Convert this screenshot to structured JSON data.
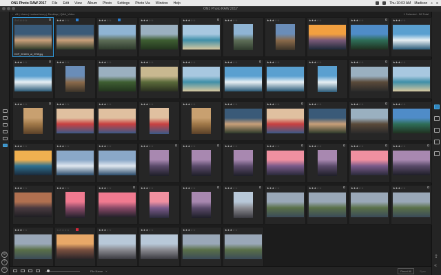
{
  "menubar": {
    "app_name": "ON1 Photo RAW 2017",
    "items": [
      "File",
      "Edit",
      "View",
      "Album",
      "Photo",
      "Settings",
      "Photo Via",
      "Window",
      "Help"
    ],
    "clock": "Thu 10:03 AM",
    "user": "Madison"
  },
  "window": {
    "title": "ON1 Photo RAW 2017"
  },
  "path": {
    "crumbs": "All | Users | hudsonhecry | Desktop | Q&A_Video",
    "selection": "1 Selected - 56 Total"
  },
  "left_rail": {
    "tools": [
      {
        "name": "browse",
        "label": "",
        "active": false
      },
      {
        "name": "develop",
        "label": "",
        "active": false
      },
      {
        "name": "effects",
        "label": "",
        "active": false
      },
      {
        "name": "layers",
        "label": "",
        "active": false
      },
      {
        "name": "resize",
        "label": "",
        "active": false
      },
      {
        "name": "smart-photo",
        "label": "",
        "active": true
      }
    ],
    "bottom": [
      "gear",
      "help",
      "power"
    ]
  },
  "right_rail": {
    "tools": [
      {
        "name": "browse",
        "label": "",
        "active": true
      },
      {
        "name": "develop",
        "label": "",
        "active": false
      },
      {
        "name": "effects",
        "label": "",
        "active": false
      },
      {
        "name": "layers",
        "label": "",
        "active": false
      },
      {
        "name": "resize",
        "label": "",
        "active": false
      }
    ]
  },
  "photos": [
    {
      "stars": 0,
      "label": "",
      "check": true,
      "kind": "family",
      "orient": "land",
      "filename": "DCP_201601_at_0708.jpg",
      "selected": true
    },
    {
      "stars": 3,
      "label": "#2a7fd4",
      "check": false,
      "kind": "family",
      "orient": "land"
    },
    {
      "stars": 3,
      "label": "#2a7fd4",
      "check": false,
      "kind": "cliff",
      "orient": "land"
    },
    {
      "stars": 3,
      "label": "",
      "check": false,
      "kind": "valley",
      "orient": "land"
    },
    {
      "stars": 3,
      "label": "",
      "check": true,
      "kind": "beach",
      "orient": "land"
    },
    {
      "stars": 3,
      "label": "",
      "check": false,
      "kind": "cliff",
      "orient": "port"
    },
    {
      "stars": 3,
      "label": "",
      "check": false,
      "kind": "climb",
      "orient": "port"
    },
    {
      "stars": 3,
      "label": "",
      "check": false,
      "kind": "sunset",
      "orient": "land"
    },
    {
      "stars": 3,
      "label": "",
      "check": true,
      "kind": "coast",
      "orient": "land"
    },
    {
      "stars": 3,
      "label": "",
      "check": false,
      "kind": "surf",
      "orient": "land"
    },
    {
      "stars": 3,
      "label": "",
      "check": true,
      "kind": "surf",
      "orient": "land"
    },
    {
      "stars": 3,
      "label": "",
      "check": false,
      "kind": "climb",
      "orient": "port"
    },
    {
      "stars": 3,
      "label": "",
      "check": false,
      "kind": "valley",
      "orient": "land"
    },
    {
      "stars": 3,
      "label": "",
      "check": false,
      "kind": "path",
      "orient": "land"
    },
    {
      "stars": 3,
      "label": "",
      "check": false,
      "kind": "beach",
      "orient": "land"
    },
    {
      "stars": 3,
      "label": "",
      "check": true,
      "kind": "surf",
      "orient": "land"
    },
    {
      "stars": 3,
      "label": "",
      "check": false,
      "kind": "surf",
      "orient": "land"
    },
    {
      "stars": 3,
      "label": "",
      "check": false,
      "kind": "surf",
      "orient": "port"
    },
    {
      "stars": 3,
      "label": "",
      "check": true,
      "kind": "rock",
      "orient": "land"
    },
    {
      "stars": 3,
      "label": "",
      "check": false,
      "kind": "beach",
      "orient": "land"
    },
    {
      "stars": 3,
      "label": "",
      "check": true,
      "kind": "sand",
      "orient": "port"
    },
    {
      "stars": 3,
      "label": "",
      "check": false,
      "kind": "kid",
      "orient": "land"
    },
    {
      "stars": 3,
      "label": "",
      "check": false,
      "kind": "kid",
      "orient": "land"
    },
    {
      "stars": 3,
      "label": "",
      "check": false,
      "kind": "kid",
      "orient": "port"
    },
    {
      "stars": 3,
      "label": "",
      "check": false,
      "kind": "sand",
      "orient": "port"
    },
    {
      "stars": 3,
      "label": "",
      "check": false,
      "kind": "family",
      "orient": "land"
    },
    {
      "stars": 3,
      "label": "",
      "check": true,
      "kind": "kid",
      "orient": "land"
    },
    {
      "stars": 3,
      "label": "",
      "check": false,
      "kind": "family",
      "orient": "land"
    },
    {
      "stars": 3,
      "label": "",
      "check": true,
      "kind": "rock",
      "orient": "land"
    },
    {
      "stars": 3,
      "label": "",
      "check": false,
      "kind": "coast",
      "orient": "land"
    },
    {
      "stars": 3,
      "label": "",
      "check": false,
      "kind": "goldwave",
      "orient": "land"
    },
    {
      "stars": 3,
      "label": "",
      "check": false,
      "kind": "wave",
      "orient": "land"
    },
    {
      "stars": 3,
      "label": "",
      "check": false,
      "kind": "wave",
      "orient": "land"
    },
    {
      "stars": 3,
      "label": "",
      "check": true,
      "kind": "duskrock",
      "orient": "port"
    },
    {
      "stars": 3,
      "label": "",
      "check": true,
      "kind": "duskrock",
      "orient": "port"
    },
    {
      "stars": 3,
      "label": "",
      "check": false,
      "kind": "duskrock",
      "orient": "port"
    },
    {
      "stars": 3,
      "label": "",
      "check": true,
      "kind": "pinkdusk",
      "orient": "land"
    },
    {
      "stars": 3,
      "label": "",
      "check": true,
      "kind": "duskrock",
      "orient": "port"
    },
    {
      "stars": 3,
      "label": "",
      "check": true,
      "kind": "pinkdusk",
      "orient": "land"
    },
    {
      "stars": 3,
      "label": "",
      "check": true,
      "kind": "duskrock",
      "orient": "land"
    },
    {
      "stars": 3,
      "label": "",
      "check": false,
      "kind": "stack",
      "orient": "land"
    },
    {
      "stars": 3,
      "label": "",
      "check": false,
      "kind": "pinkstack",
      "orient": "port"
    },
    {
      "stars": 3,
      "label": "",
      "check": true,
      "kind": "pinkstack",
      "orient": "land"
    },
    {
      "stars": 3,
      "label": "",
      "check": false,
      "kind": "pinkdusk",
      "orient": "port"
    },
    {
      "stars": 3,
      "label": "",
      "check": true,
      "kind": "duskrock",
      "orient": "port"
    },
    {
      "stars": 3,
      "label": "",
      "check": true,
      "kind": "mountain",
      "orient": "port"
    },
    {
      "stars": 3,
      "label": "",
      "check": false,
      "kind": "lake",
      "orient": "land"
    },
    {
      "stars": 3,
      "label": "",
      "check": true,
      "kind": "lake",
      "orient": "land"
    },
    {
      "stars": 3,
      "label": "",
      "check": false,
      "kind": "lake",
      "orient": "land"
    },
    {
      "stars": 3,
      "label": "",
      "check": true,
      "kind": "lake",
      "orient": "land"
    },
    {
      "stars": 3,
      "label": "",
      "check": false,
      "kind": "lake",
      "orient": "land"
    },
    {
      "stars": 0,
      "label": "#d4283a",
      "check": false,
      "kind": "peaks",
      "orient": "land"
    },
    {
      "stars": 3,
      "label": "",
      "check": false,
      "kind": "mountain",
      "orient": "land"
    },
    {
      "stars": 3,
      "label": "",
      "check": false,
      "kind": "mountain",
      "orient": "land"
    },
    {
      "stars": 3,
      "label": "",
      "check": false,
      "kind": "lake",
      "orient": "land"
    },
    {
      "stars": 3,
      "label": "",
      "check": false,
      "kind": "lake",
      "orient": "land"
    }
  ],
  "palettes": {
    "family": [
      "#3a5a78",
      "#c9a07a",
      "#2d3a2a"
    ],
    "cliff": [
      "#8fb4d4",
      "#5e6e58",
      "#2e3a2c"
    ],
    "valley": [
      "#9bb0c0",
      "#3e5e32",
      "#22341e"
    ],
    "beach": [
      "#a8c8e0",
      "#3f8fa8",
      "#d8c8a0"
    ],
    "climb": [
      "#6a8db8",
      "#8a6a4a",
      "#3a3228"
    ],
    "sunset": [
      "#f2a040",
      "#7a5a78",
      "#1e2a3a"
    ],
    "coast": [
      "#4f8cc8",
      "#2e6e58",
      "#203020"
    ],
    "surf": [
      "#5aa0d0",
      "#e8f0f4",
      "#2a5a78"
    ],
    "path": [
      "#c8b890",
      "#5a6a3a",
      "#2a3020"
    ],
    "rock": [
      "#9ab0c0",
      "#5a4a3a",
      "#2a2a2a"
    ],
    "sand": [
      "#c8a070",
      "#a07848",
      "#5a4028"
    ],
    "kid": [
      "#e0c0a0",
      "#c84040",
      "#3a5a88"
    ],
    "goldwave": [
      "#f0b050",
      "#2e7090",
      "#1a2a3a"
    ],
    "wave": [
      "#8aa8c8",
      "#e0e8f0",
      "#2a4a6a"
    ],
    "duskrock": [
      "#a888b0",
      "#5a4a6a",
      "#1e1e28"
    ],
    "pinkdusk": [
      "#f090a0",
      "#7a5a8a",
      "#2a2a3a"
    ],
    "stack": [
      "#b07050",
      "#4a3a40",
      "#1e1e22"
    ],
    "pinkstack": [
      "#f07a90",
      "#8a4a68",
      "#22202a"
    ],
    "mountain": [
      "#b8c8d8",
      "#8a8a90",
      "#3a3a40"
    ],
    "lake": [
      "#9aa8b8",
      "#5a7048",
      "#3a4a58"
    ],
    "peaks": [
      "#e8a868",
      "#7a5040",
      "#2a2428"
    ]
  },
  "bottombar": {
    "sort_label": "File Name",
    "reset_label": "Reset All",
    "sync_label": "Sync"
  },
  "colors": {
    "accent": "#2f9be0",
    "background": "#1a1a1a"
  }
}
